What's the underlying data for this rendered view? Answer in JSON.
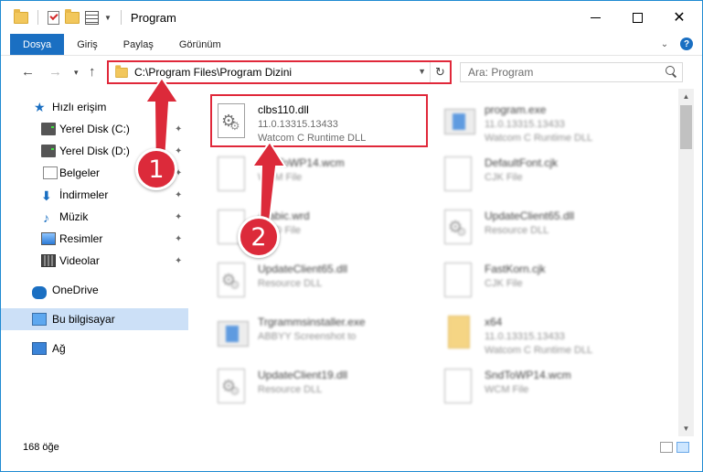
{
  "window": {
    "title": "Program",
    "controls": {
      "minimize": "",
      "maximize": "",
      "close": "✕"
    }
  },
  "ribbon": {
    "tabs": [
      "Dosya",
      "Giriş",
      "Paylaş",
      "Görünüm"
    ],
    "expand_icon": "chevron-down-icon",
    "help_label": "?"
  },
  "navigation": {
    "back": "←",
    "forward": "→",
    "recent": "▾",
    "up": "↑",
    "address": "C:\\Program Files\\Program Dizini",
    "refresh": "↻",
    "search_placeholder": "Ara: Program"
  },
  "sidebar": {
    "items": [
      {
        "label": "Hızlı erişim",
        "icon": "star-icon",
        "pinned": false
      },
      {
        "label": "Yerel Disk (C:)",
        "icon": "disk-icon",
        "pinned": true
      },
      {
        "label": "Yerel Disk (D:)",
        "icon": "disk-icon",
        "pinned": true
      },
      {
        "label": "Belgeler",
        "icon": "document-icon",
        "pinned": true
      },
      {
        "label": "İndirmeler",
        "icon": "download-icon",
        "pinned": true
      },
      {
        "label": "Müzik",
        "icon": "music-icon",
        "pinned": true
      },
      {
        "label": "Resimler",
        "icon": "pictures-icon",
        "pinned": true
      },
      {
        "label": "Videolar",
        "icon": "video-icon",
        "pinned": true
      },
      {
        "label": "OneDrive",
        "icon": "cloud-icon",
        "pinned": false
      },
      {
        "label": "Bu bilgisayar",
        "icon": "computer-icon",
        "pinned": false,
        "selected": true
      },
      {
        "label": "Ağ",
        "icon": "network-icon",
        "pinned": false
      }
    ],
    "pin_glyph": "📌"
  },
  "files": [
    {
      "name": "clbs110.dll",
      "line1": "11.0.13315.13433",
      "line2": "Watcom C Runtime DLL",
      "icon": "dll-icon",
      "highlighted": true
    },
    {
      "name": "program.exe",
      "line1": "11.0.13315.13433",
      "line2": "Watcom C Runtime DLL",
      "icon": "exe-icon"
    },
    {
      "name": "SndToWP14.wcm",
      "line1": "WCM File",
      "line2": "",
      "icon": "file-icon"
    },
    {
      "name": "DefaultFont.cjk",
      "line1": "CJK File",
      "line2": "",
      "icon": "file-icon"
    },
    {
      "name": "Arabic.wrd",
      "line1": "WRD File",
      "line2": "",
      "icon": "file-icon"
    },
    {
      "name": "UpdateClient65.dll",
      "line1": "Resource DLL",
      "line2": "",
      "icon": "dll-icon"
    },
    {
      "name": "UpdateClient65.dll",
      "line1": "Resource DLL",
      "line2": "",
      "icon": "dll-icon"
    },
    {
      "name": "FastKorn.cjk",
      "line1": "CJK File",
      "line2": "",
      "icon": "file-icon"
    },
    {
      "name": "Trgrammsinstaller.exe",
      "line1": "ABBYY Screenshot to",
      "line2": "",
      "icon": "exe-icon"
    },
    {
      "name": "x64",
      "line1": "11.0.13315.13433",
      "line2": "Watcom C Runtime DLL",
      "icon": "folder-icon"
    },
    {
      "name": "UpdateClient19.dll",
      "line1": "Resource DLL",
      "line2": "",
      "icon": "dll-icon"
    },
    {
      "name": "SndToWP14.wcm",
      "line1": "WCM File",
      "line2": "",
      "icon": "file-icon"
    }
  ],
  "scrollbar": {
    "up": "▲",
    "down": "▼"
  },
  "status": {
    "item_count": "168 öğe"
  },
  "annotations": [
    {
      "number": "1",
      "color": "#dc2a3a"
    },
    {
      "number": "2",
      "color": "#dc2a3a"
    }
  ],
  "colors": {
    "accent": "#1a6fc2",
    "highlight": "#e0283a",
    "selected_nav": "#cce0f7"
  }
}
